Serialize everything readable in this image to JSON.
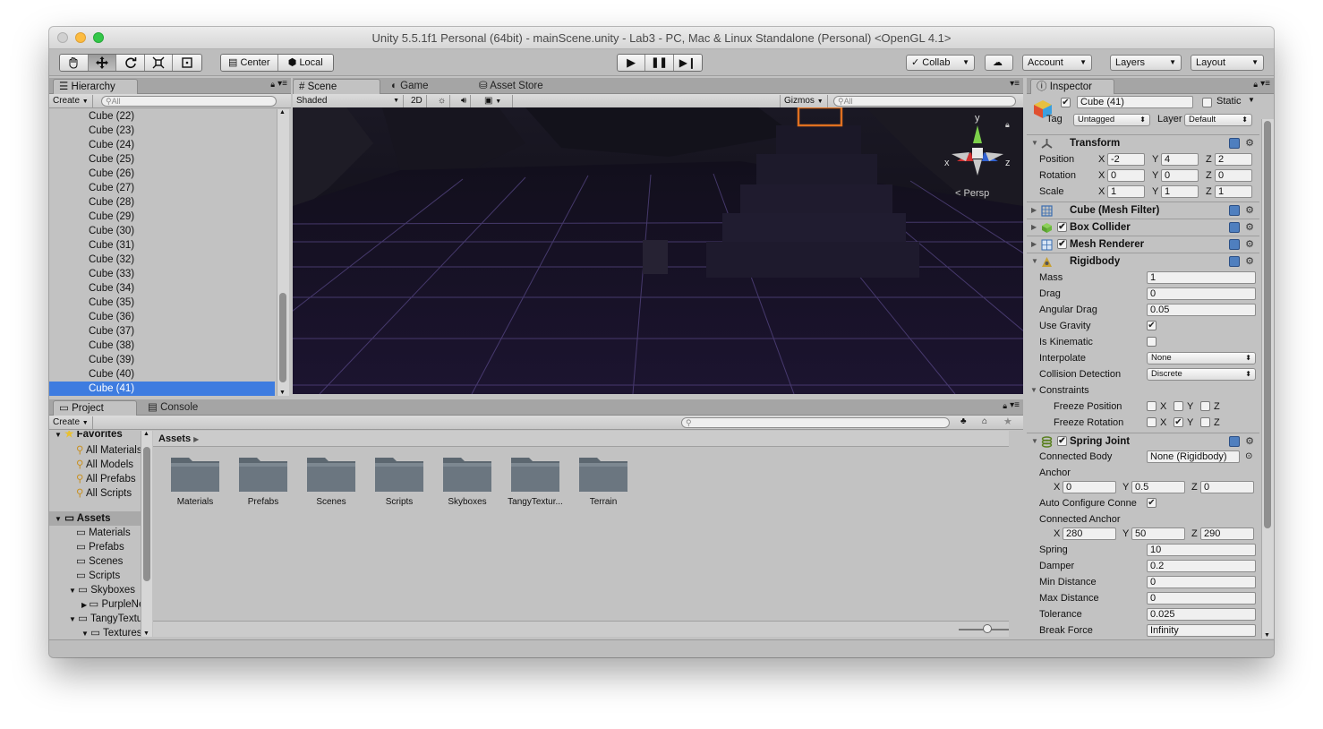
{
  "window": {
    "title": "Unity 5.5.1f1 Personal (64bit) - mainScene.unity - Lab3 - PC, Mac & Linux Standalone (Personal) <OpenGL 4.1>"
  },
  "toolbar": {
    "pivot": "Center",
    "space": "Local",
    "collab": "Collab",
    "account": "Account",
    "layers": "Layers",
    "layout": "Layout"
  },
  "hierarchy": {
    "tab": "Hierarchy",
    "create": "Create",
    "search_placeholder": "All",
    "items": [
      "Cube (22)",
      "Cube (23)",
      "Cube (24)",
      "Cube (25)",
      "Cube (26)",
      "Cube (27)",
      "Cube (28)",
      "Cube (29)",
      "Cube (30)",
      "Cube (31)",
      "Cube (32)",
      "Cube (33)",
      "Cube (34)",
      "Cube (35)",
      "Cube (36)",
      "Cube (37)",
      "Cube (38)",
      "Cube (39)",
      "Cube (40)",
      "Cube (41)"
    ],
    "selected": "Cube (41)"
  },
  "scene": {
    "tabs": {
      "scene": "Scene",
      "game": "Game",
      "asset_store": "Asset Store"
    },
    "shading": "Shaded",
    "mode_2d": "2D",
    "gizmos": "Gizmos",
    "search_placeholder": "All",
    "persp": "Persp",
    "axis_x": "x",
    "axis_y": "y",
    "axis_z": "z"
  },
  "project": {
    "tab": "Project",
    "console_tab": "Console",
    "create": "Create",
    "breadcrumb": "Assets",
    "favorites_label": "Favorites",
    "favorites": [
      "All Materials",
      "All Models",
      "All Prefabs",
      "All Scripts"
    ],
    "assets_label": "Assets",
    "tree": [
      "Materials",
      "Prefabs",
      "Scenes",
      "Scripts",
      "Skyboxes",
      "PurpleNebula",
      "TangyTextures",
      "Textures"
    ],
    "folders": [
      "Materials",
      "Prefabs",
      "Scenes",
      "Scripts",
      "Skyboxes",
      "TangyTextur...",
      "Terrain"
    ]
  },
  "inspector": {
    "tab": "Inspector",
    "object_name": "Cube (41)",
    "static_label": "Static",
    "tag_label": "Tag",
    "tag_value": "Untagged",
    "layer_label": "Layer",
    "layer_value": "Default",
    "transform": {
      "title": "Transform",
      "position_label": "Position",
      "position": [
        "-2",
        "4",
        "2"
      ],
      "rotation_label": "Rotation",
      "rotation": [
        "0",
        "0",
        "0"
      ],
      "scale_label": "Scale",
      "scale": [
        "1",
        "1",
        "1"
      ]
    },
    "mesh_filter": "Cube (Mesh Filter)",
    "box_collider": "Box Collider",
    "mesh_renderer": "Mesh Renderer",
    "rigidbody": {
      "title": "Rigidbody",
      "mass_label": "Mass",
      "mass": "1",
      "drag_label": "Drag",
      "drag": "0",
      "angular_drag_label": "Angular Drag",
      "angular_drag": "0.05",
      "use_gravity_label": "Use Gravity",
      "use_gravity": true,
      "is_kinematic_label": "Is Kinematic",
      "is_kinematic": false,
      "interpolate_label": "Interpolate",
      "interpolate": "None",
      "collision_label": "Collision Detection",
      "collision": "Discrete",
      "constraints_label": "Constraints",
      "freeze_position_label": "Freeze Position",
      "freeze_rotation_label": "Freeze Rotation"
    },
    "spring_joint": {
      "title": "Spring Joint",
      "connected_body_label": "Connected Body",
      "connected_body": "None (Rigidbody)",
      "anchor_label": "Anchor",
      "anchor": [
        "0",
        "0.5",
        "0"
      ],
      "auto_configure_label": "Auto Configure Conne",
      "connected_anchor_label": "Connected Anchor",
      "connected_anchor": [
        "280",
        "50",
        "290"
      ],
      "spring_label": "Spring",
      "spring": "10",
      "damper_label": "Damper",
      "damper": "0.2",
      "min_distance_label": "Min Distance",
      "min_distance": "0",
      "max_distance_label": "Max Distance",
      "max_distance": "0",
      "tolerance_label": "Tolerance",
      "tolerance": "0.025",
      "break_force_label": "Break Force",
      "break_force": "Infinity"
    }
  },
  "axis_letters": {
    "x": "X",
    "y": "Y",
    "z": "Z"
  },
  "colors": {
    "selection": "#3e7ce0",
    "scene_bg": "#0d0b14",
    "grid": "#5a4a8a"
  }
}
